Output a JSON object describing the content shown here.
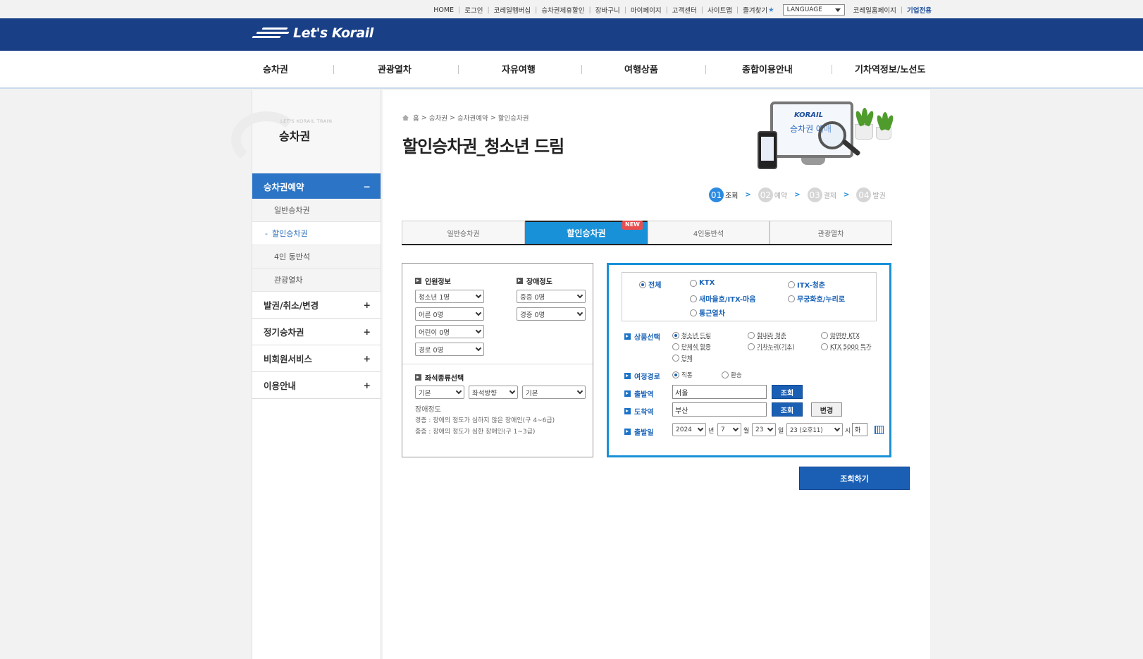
{
  "util": {
    "links": [
      "HOME",
      "로그인",
      "코레일멤버십",
      "승차권제휴할인",
      "장바구니",
      "마이페이지",
      "고객센터",
      "사이트맵",
      "즐겨찾기"
    ],
    "language": "LANGUAGE",
    "homepage": "코레일홈페이지",
    "business": "기업전용"
  },
  "logo": {
    "text": "Let's Korail"
  },
  "gnb": [
    "승차권",
    "관광열차",
    "자유여행",
    "여행상품",
    "종합이용안내",
    "기차역정보/노선도"
  ],
  "sidebar": {
    "sub": "LET'S KORAIL TRAIN",
    "title": "승차권",
    "active": "승차권예약",
    "active_sign": "−",
    "sub_items": [
      "일반승차권",
      "할인승차권",
      "4인 동반석",
      "관광열차"
    ],
    "current_dash": "-",
    "menus": [
      "발권/취소/변경",
      "정기승차권",
      "비회원서비스",
      "이용안내"
    ],
    "plus": "+"
  },
  "breadcrumb": [
    "홈",
    ">",
    "승차권",
    ">",
    "승차권예약",
    ">",
    "할인승차권"
  ],
  "page_title": "할인승차권_청소년 드림",
  "hero": {
    "brand": "KORAIL",
    "text": "승차권 예매"
  },
  "steps": [
    {
      "num": "01",
      "label": "조회",
      "arrow": ">"
    },
    {
      "num": "02",
      "label": "예약",
      "arrow": ">"
    },
    {
      "num": "03",
      "label": "결제",
      "arrow": ">"
    },
    {
      "num": "04",
      "label": "발권",
      "arrow": ""
    }
  ],
  "tabs": [
    "일반승차권",
    "할인승차권",
    "4인동반석",
    "관광열차"
  ],
  "new_badge": "NEW",
  "passenger": {
    "label": "인원정보",
    "selects": [
      "청소년 1명",
      "어른 0명",
      "어린이 0명",
      "경로 0명"
    ]
  },
  "disability": {
    "label": "장애정도",
    "selects": [
      "중증 0명",
      "경증 0명"
    ]
  },
  "seat": {
    "label": "좌석종류선택",
    "selects": [
      "기본",
      "좌석방향",
      "기본"
    ]
  },
  "disability_note": {
    "title": "장애정도",
    "lines": [
      "경증 : 장애의 정도가 심하지 않은 장애인(구 4~6급)",
      "중증 : 장애의 정도가 심한 장애인(구 1~3급)"
    ]
  },
  "trains": [
    "전체",
    "KTX",
    "ITX-청춘",
    "새마을호/ITX-마음",
    "무궁화호/누리로",
    "통근열차"
  ],
  "product": {
    "label": "상품선택",
    "options": [
      "청소년 드림",
      "힘내라 청춘",
      "맘편한 KTX",
      "단체석 할증",
      "기차누리(기초)",
      "KTX 5000 특가",
      "단체"
    ]
  },
  "route": {
    "label": "여정경로",
    "options": [
      "직통",
      "환승"
    ]
  },
  "departure": {
    "label": "출발역",
    "value": "서울",
    "btn": "조회"
  },
  "arrival": {
    "label": "도착역",
    "value": "부산",
    "btn": "조회",
    "swap": "변경"
  },
  "date": {
    "label": "출발일",
    "year": "2024",
    "year_unit": "년",
    "month": "7",
    "month_unit": "월",
    "day": "23",
    "day_unit": "일",
    "hour": "23 (오후11)",
    "hour_unit": "시",
    "min": "화"
  },
  "search_btn": "조회하기"
}
